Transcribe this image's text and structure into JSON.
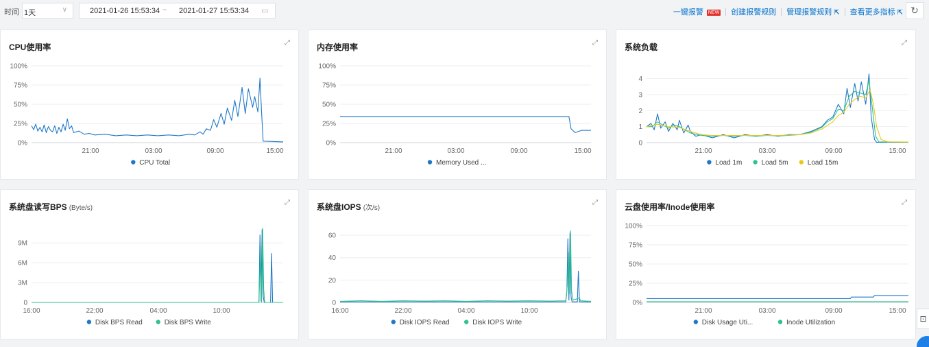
{
  "toolbar": {
    "range_label": "时间",
    "range_value": "1天",
    "date_start": "2021-01-26 15:53:34",
    "date_sep": "~",
    "date_end": "2021-01-27 15:53:34",
    "actions": {
      "one_click_alarm": "一键报警",
      "new_badge": "NEW",
      "create_rule": "创建报警规则",
      "manage_rule": "管理报警规则",
      "more_metrics": "查看更多指标"
    }
  },
  "panels": {
    "cpu": {
      "title": "CPU使用率"
    },
    "mem": {
      "title": "内存使用率"
    },
    "load": {
      "title": "系统负载"
    },
    "bps": {
      "title": "系统盘读写BPS",
      "unit": "(Byte/s)"
    },
    "iops": {
      "title": "系统盘IOPS",
      "unit": "(次/s)"
    },
    "cloud": {
      "title": "云盘使用率/Inode使用率"
    }
  },
  "colors": {
    "blue": "#1f77c7",
    "green": "#2ec28f",
    "yellow": "#e8c91a"
  },
  "chart_data": [
    {
      "id": "cpu",
      "type": "line",
      "yticks": [
        "100%",
        "75%",
        "50%",
        "25%",
        "0%"
      ],
      "ylim": [
        0,
        100
      ],
      "xticks": [
        "21:00",
        "03:00",
        "09:00",
        "15:00"
      ],
      "series": [
        {
          "name": "CPU Total",
          "color": "#1f77c7",
          "values": [
            [
              0,
              22
            ],
            [
              0.2,
              17
            ],
            [
              0.4,
              24
            ],
            [
              0.6,
              15
            ],
            [
              0.8,
              20
            ],
            [
              1,
              14
            ],
            [
              1.2,
              23
            ],
            [
              1.4,
              13
            ],
            [
              1.6,
              21
            ],
            [
              1.8,
              16
            ],
            [
              2,
              14
            ],
            [
              2.2,
              22
            ],
            [
              2.4,
              12
            ],
            [
              2.6,
              20
            ],
            [
              2.8,
              14
            ],
            [
              3,
              24
            ],
            [
              3.2,
              16
            ],
            [
              3.4,
              31
            ],
            [
              3.6,
              18
            ],
            [
              3.8,
              22
            ],
            [
              4,
              13
            ],
            [
              4.5,
              15
            ],
            [
              5,
              11
            ],
            [
              5.5,
              12
            ],
            [
              6,
              10
            ],
            [
              7,
              11
            ],
            [
              8,
              9
            ],
            [
              9,
              10
            ],
            [
              10,
              9
            ],
            [
              11,
              10
            ],
            [
              12,
              9
            ],
            [
              13,
              10
            ],
            [
              14,
              9
            ],
            [
              15,
              11
            ],
            [
              15.5,
              10
            ],
            [
              16,
              14
            ],
            [
              16.3,
              11
            ],
            [
              16.6,
              18
            ],
            [
              17,
              16
            ],
            [
              17.3,
              30
            ],
            [
              17.6,
              20
            ],
            [
              18,
              38
            ],
            [
              18.3,
              24
            ],
            [
              18.6,
              45
            ],
            [
              19,
              29
            ],
            [
              19.3,
              55
            ],
            [
              19.6,
              34
            ],
            [
              20,
              72
            ],
            [
              20.3,
              38
            ],
            [
              20.6,
              70
            ],
            [
              21,
              46
            ],
            [
              21.2,
              60
            ],
            [
              21.5,
              40
            ],
            [
              21.7,
              84
            ],
            [
              21.85,
              40
            ],
            [
              22,
              2
            ],
            [
              23.9,
              1
            ]
          ]
        }
      ]
    },
    {
      "id": "mem",
      "type": "line",
      "yticks": [
        "100%",
        "75%",
        "50%",
        "25%",
        "0%"
      ],
      "ylim": [
        0,
        100
      ],
      "xticks": [
        "21:00",
        "03:00",
        "09:00",
        "15:00"
      ],
      "series": [
        {
          "name": "Memory Used ...",
          "color": "#1f77c7",
          "values": [
            [
              0,
              34
            ],
            [
              21.8,
              34
            ],
            [
              22,
              18
            ],
            [
              22.4,
              13
            ],
            [
              23,
              16
            ],
            [
              23.9,
              16
            ]
          ]
        }
      ]
    },
    {
      "id": "load",
      "type": "line",
      "yticks": [
        "4",
        "3",
        "2",
        "1",
        "0"
      ],
      "ylim": [
        0,
        4.8
      ],
      "xticks": [
        "21:00",
        "03:00",
        "09:00",
        "15:00"
      ],
      "series": [
        {
          "name": "Load 1m",
          "color": "#1f77c7",
          "values": [
            [
              0,
              1.0
            ],
            [
              0.4,
              1.2
            ],
            [
              0.7,
              0.8
            ],
            [
              1,
              1.8
            ],
            [
              1.3,
              0.9
            ],
            [
              1.7,
              1.3
            ],
            [
              2,
              0.7
            ],
            [
              2.4,
              1.2
            ],
            [
              2.8,
              0.8
            ],
            [
              3,
              1.4
            ],
            [
              3.4,
              0.6
            ],
            [
              3.8,
              1.1
            ],
            [
              4,
              0.7
            ],
            [
              4.5,
              0.4
            ],
            [
              5,
              0.5
            ],
            [
              6,
              0.3
            ],
            [
              7,
              0.5
            ],
            [
              8,
              0.3
            ],
            [
              9,
              0.5
            ],
            [
              10,
              0.4
            ],
            [
              11,
              0.5
            ],
            [
              12,
              0.4
            ],
            [
              13,
              0.5
            ],
            [
              14,
              0.5
            ],
            [
              15,
              0.7
            ],
            [
              16,
              1.0
            ],
            [
              16.5,
              1.4
            ],
            [
              17,
              1.6
            ],
            [
              17.5,
              2.4
            ],
            [
              18,
              1.8
            ],
            [
              18.3,
              3.4
            ],
            [
              18.6,
              2.2
            ],
            [
              19,
              3.7
            ],
            [
              19.3,
              2.6
            ],
            [
              19.6,
              3.8
            ],
            [
              20,
              2.4
            ],
            [
              20.3,
              4.3
            ],
            [
              20.5,
              1.6
            ],
            [
              20.8,
              0.2
            ],
            [
              21,
              0.02
            ],
            [
              23.9,
              0.02
            ]
          ]
        },
        {
          "name": "Load 5m",
          "color": "#2ec28f",
          "values": [
            [
              0,
              1.0
            ],
            [
              0.5,
              1.0
            ],
            [
              1,
              1.3
            ],
            [
              1.5,
              1.1
            ],
            [
              2,
              0.9
            ],
            [
              2.5,
              1.1
            ],
            [
              3,
              1.0
            ],
            [
              3.5,
              0.8
            ],
            [
              4,
              0.6
            ],
            [
              5,
              0.45
            ],
            [
              6,
              0.4
            ],
            [
              7,
              0.45
            ],
            [
              8,
              0.4
            ],
            [
              9,
              0.45
            ],
            [
              10,
              0.4
            ],
            [
              11,
              0.45
            ],
            [
              12,
              0.42
            ],
            [
              13,
              0.45
            ],
            [
              14,
              0.5
            ],
            [
              15,
              0.65
            ],
            [
              16,
              0.95
            ],
            [
              16.5,
              1.3
            ],
            [
              17,
              1.5
            ],
            [
              17.5,
              2.1
            ],
            [
              18,
              2.0
            ],
            [
              18.5,
              2.9
            ],
            [
              19,
              3.2
            ],
            [
              19.5,
              3.1
            ],
            [
              20,
              3.0
            ],
            [
              20.3,
              3.9
            ],
            [
              20.6,
              2.2
            ],
            [
              20.9,
              0.4
            ],
            [
              21.2,
              0.05
            ],
            [
              23.9,
              0.03
            ]
          ]
        },
        {
          "name": "Load 15m",
          "color": "#e8c91a",
          "values": [
            [
              0,
              1.0
            ],
            [
              1,
              1.15
            ],
            [
              2,
              1.0
            ],
            [
              3,
              0.95
            ],
            [
              4,
              0.7
            ],
            [
              5,
              0.5
            ],
            [
              6,
              0.45
            ],
            [
              7,
              0.45
            ],
            [
              8,
              0.45
            ],
            [
              9,
              0.45
            ],
            [
              10,
              0.45
            ],
            [
              11,
              0.45
            ],
            [
              12,
              0.45
            ],
            [
              13,
              0.47
            ],
            [
              14,
              0.5
            ],
            [
              15,
              0.6
            ],
            [
              16,
              0.85
            ],
            [
              17,
              1.3
            ],
            [
              17.5,
              1.7
            ],
            [
              18,
              1.9
            ],
            [
              18.5,
              2.4
            ],
            [
              19,
              2.7
            ],
            [
              19.5,
              2.9
            ],
            [
              20,
              2.8
            ],
            [
              20.4,
              3.3
            ],
            [
              20.7,
              2.4
            ],
            [
              21,
              1.0
            ],
            [
              21.4,
              0.2
            ],
            [
              22,
              0.05
            ],
            [
              23.9,
              0.04
            ]
          ]
        }
      ]
    },
    {
      "id": "bps",
      "type": "line",
      "yticks": [
        "9M",
        "6M",
        "3M",
        "0"
      ],
      "ylim": [
        0,
        11500000
      ],
      "xticks": [
        "16:00",
        "22:00",
        "04:00",
        "10:00"
      ],
      "series": [
        {
          "name": "Disk BPS Read",
          "color": "#1f77c7",
          "values": [
            [
              0,
              0
            ],
            [
              21.6,
              0
            ],
            [
              21.7,
              10200000
            ],
            [
              21.8,
              200000
            ],
            [
              21.9,
              11000000
            ],
            [
              22,
              1000000
            ],
            [
              22.1,
              0
            ],
            [
              22.7,
              0
            ],
            [
              22.8,
              7400000
            ],
            [
              22.9,
              0
            ],
            [
              23.9,
              0
            ]
          ]
        },
        {
          "name": "Disk BPS Write",
          "color": "#2ec28f",
          "values": [
            [
              0,
              0
            ],
            [
              21.6,
              0
            ],
            [
              21.75,
              8500000
            ],
            [
              21.85,
              0
            ],
            [
              21.95,
              11200000
            ],
            [
              22.05,
              2000000
            ],
            [
              22.15,
              0
            ],
            [
              23.9,
              0
            ]
          ]
        }
      ]
    },
    {
      "id": "iops",
      "type": "line",
      "yticks": [
        "60",
        "40",
        "20",
        "0"
      ],
      "ylim": [
        0,
        68
      ],
      "xticks": [
        "16:00",
        "22:00",
        "04:00",
        "10:00"
      ],
      "series": [
        {
          "name": "Disk IOPS Read",
          "color": "#1f77c7",
          "values": [
            [
              0,
              0.5
            ],
            [
              21.5,
              0.5
            ],
            [
              21.6,
              10
            ],
            [
              21.7,
              57
            ],
            [
              21.8,
              2
            ],
            [
              21.9,
              62
            ],
            [
              22,
              5
            ],
            [
              22.1,
              0.5
            ],
            [
              22.6,
              0.5
            ],
            [
              22.7,
              28
            ],
            [
              22.8,
              0.5
            ],
            [
              23.9,
              0.5
            ]
          ]
        },
        {
          "name": "Disk IOPS Write",
          "color": "#2ec28f",
          "values": [
            [
              0,
              1
            ],
            [
              2,
              1.5
            ],
            [
              4,
              1
            ],
            [
              6,
              1.5
            ],
            [
              8,
              1.2
            ],
            [
              10,
              1.5
            ],
            [
              12,
              1
            ],
            [
              14,
              1.5
            ],
            [
              16,
              1.2
            ],
            [
              18,
              1.5
            ],
            [
              20,
              1.2
            ],
            [
              21.5,
              1.5
            ],
            [
              21.65,
              15
            ],
            [
              21.75,
              45
            ],
            [
              21.85,
              8
            ],
            [
              21.95,
              64
            ],
            [
              22.05,
              10
            ],
            [
              22.2,
              2
            ],
            [
              22.8,
              4
            ],
            [
              22.9,
              1.5
            ],
            [
              23.9,
              1
            ]
          ]
        }
      ]
    },
    {
      "id": "cloud",
      "type": "line",
      "yticks": [
        "100%",
        "75%",
        "50%",
        "25%",
        "0%"
      ],
      "ylim": [
        0,
        100
      ],
      "xticks": [
        "21:00",
        "03:00",
        "09:00",
        "15:00"
      ],
      "series": [
        {
          "name": "Disk Usage Uti...",
          "color": "#1f77c7",
          "values": [
            [
              0,
              5
            ],
            [
              18.6,
              5
            ],
            [
              18.7,
              7
            ],
            [
              20.7,
              7
            ],
            [
              20.8,
              9
            ],
            [
              23.9,
              9
            ]
          ]
        },
        {
          "name": "Inode Utilization",
          "color": "#2ec28f",
          "values": [
            [
              0,
              1
            ],
            [
              23.9,
              1
            ]
          ]
        }
      ]
    }
  ]
}
